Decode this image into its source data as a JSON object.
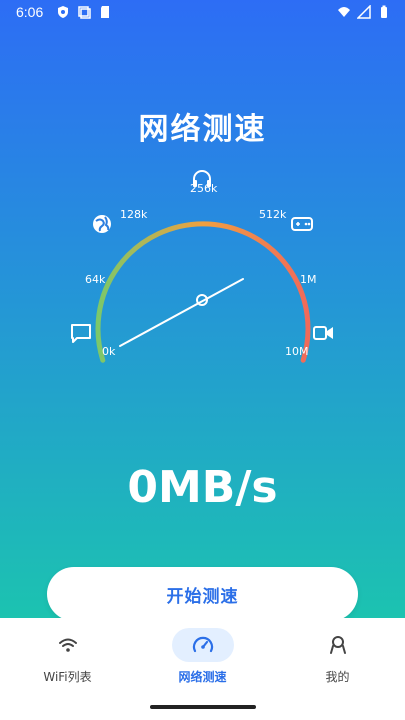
{
  "status_bar": {
    "time": "6:06",
    "icons_left": [
      "shield-icon",
      "copy-icon",
      "sd-card-icon"
    ],
    "icons_right": [
      "wifi-icon",
      "signal-icon",
      "battery-icon"
    ]
  },
  "header": {
    "title": "网络测速"
  },
  "gauge": {
    "tick_labels": [
      "0k",
      "64k",
      "128k",
      "256k",
      "512k",
      "1M",
      "10M"
    ],
    "icons": [
      "chat-icon",
      "globe-icon",
      "headphones-icon",
      "gamepad-icon",
      "video-icon"
    ],
    "needle_level": 0.5,
    "arc_colors": [
      "#7bc86a",
      "#f0a040",
      "#f06a5a"
    ]
  },
  "speed": {
    "value": "0MB/s"
  },
  "start_button": {
    "label": "开始测速"
  },
  "bottom_nav": {
    "items": [
      {
        "label": "WiFi列表",
        "icon": "wifi-icon",
        "active": false
      },
      {
        "label": "网络测速",
        "icon": "speedometer-icon",
        "active": true
      },
      {
        "label": "我的",
        "icon": "person-icon",
        "active": false
      }
    ]
  },
  "colors": {
    "accent": "#2b6fe8",
    "bg_top": "#2d6df5",
    "bg_bottom": "#1cc3b0"
  }
}
